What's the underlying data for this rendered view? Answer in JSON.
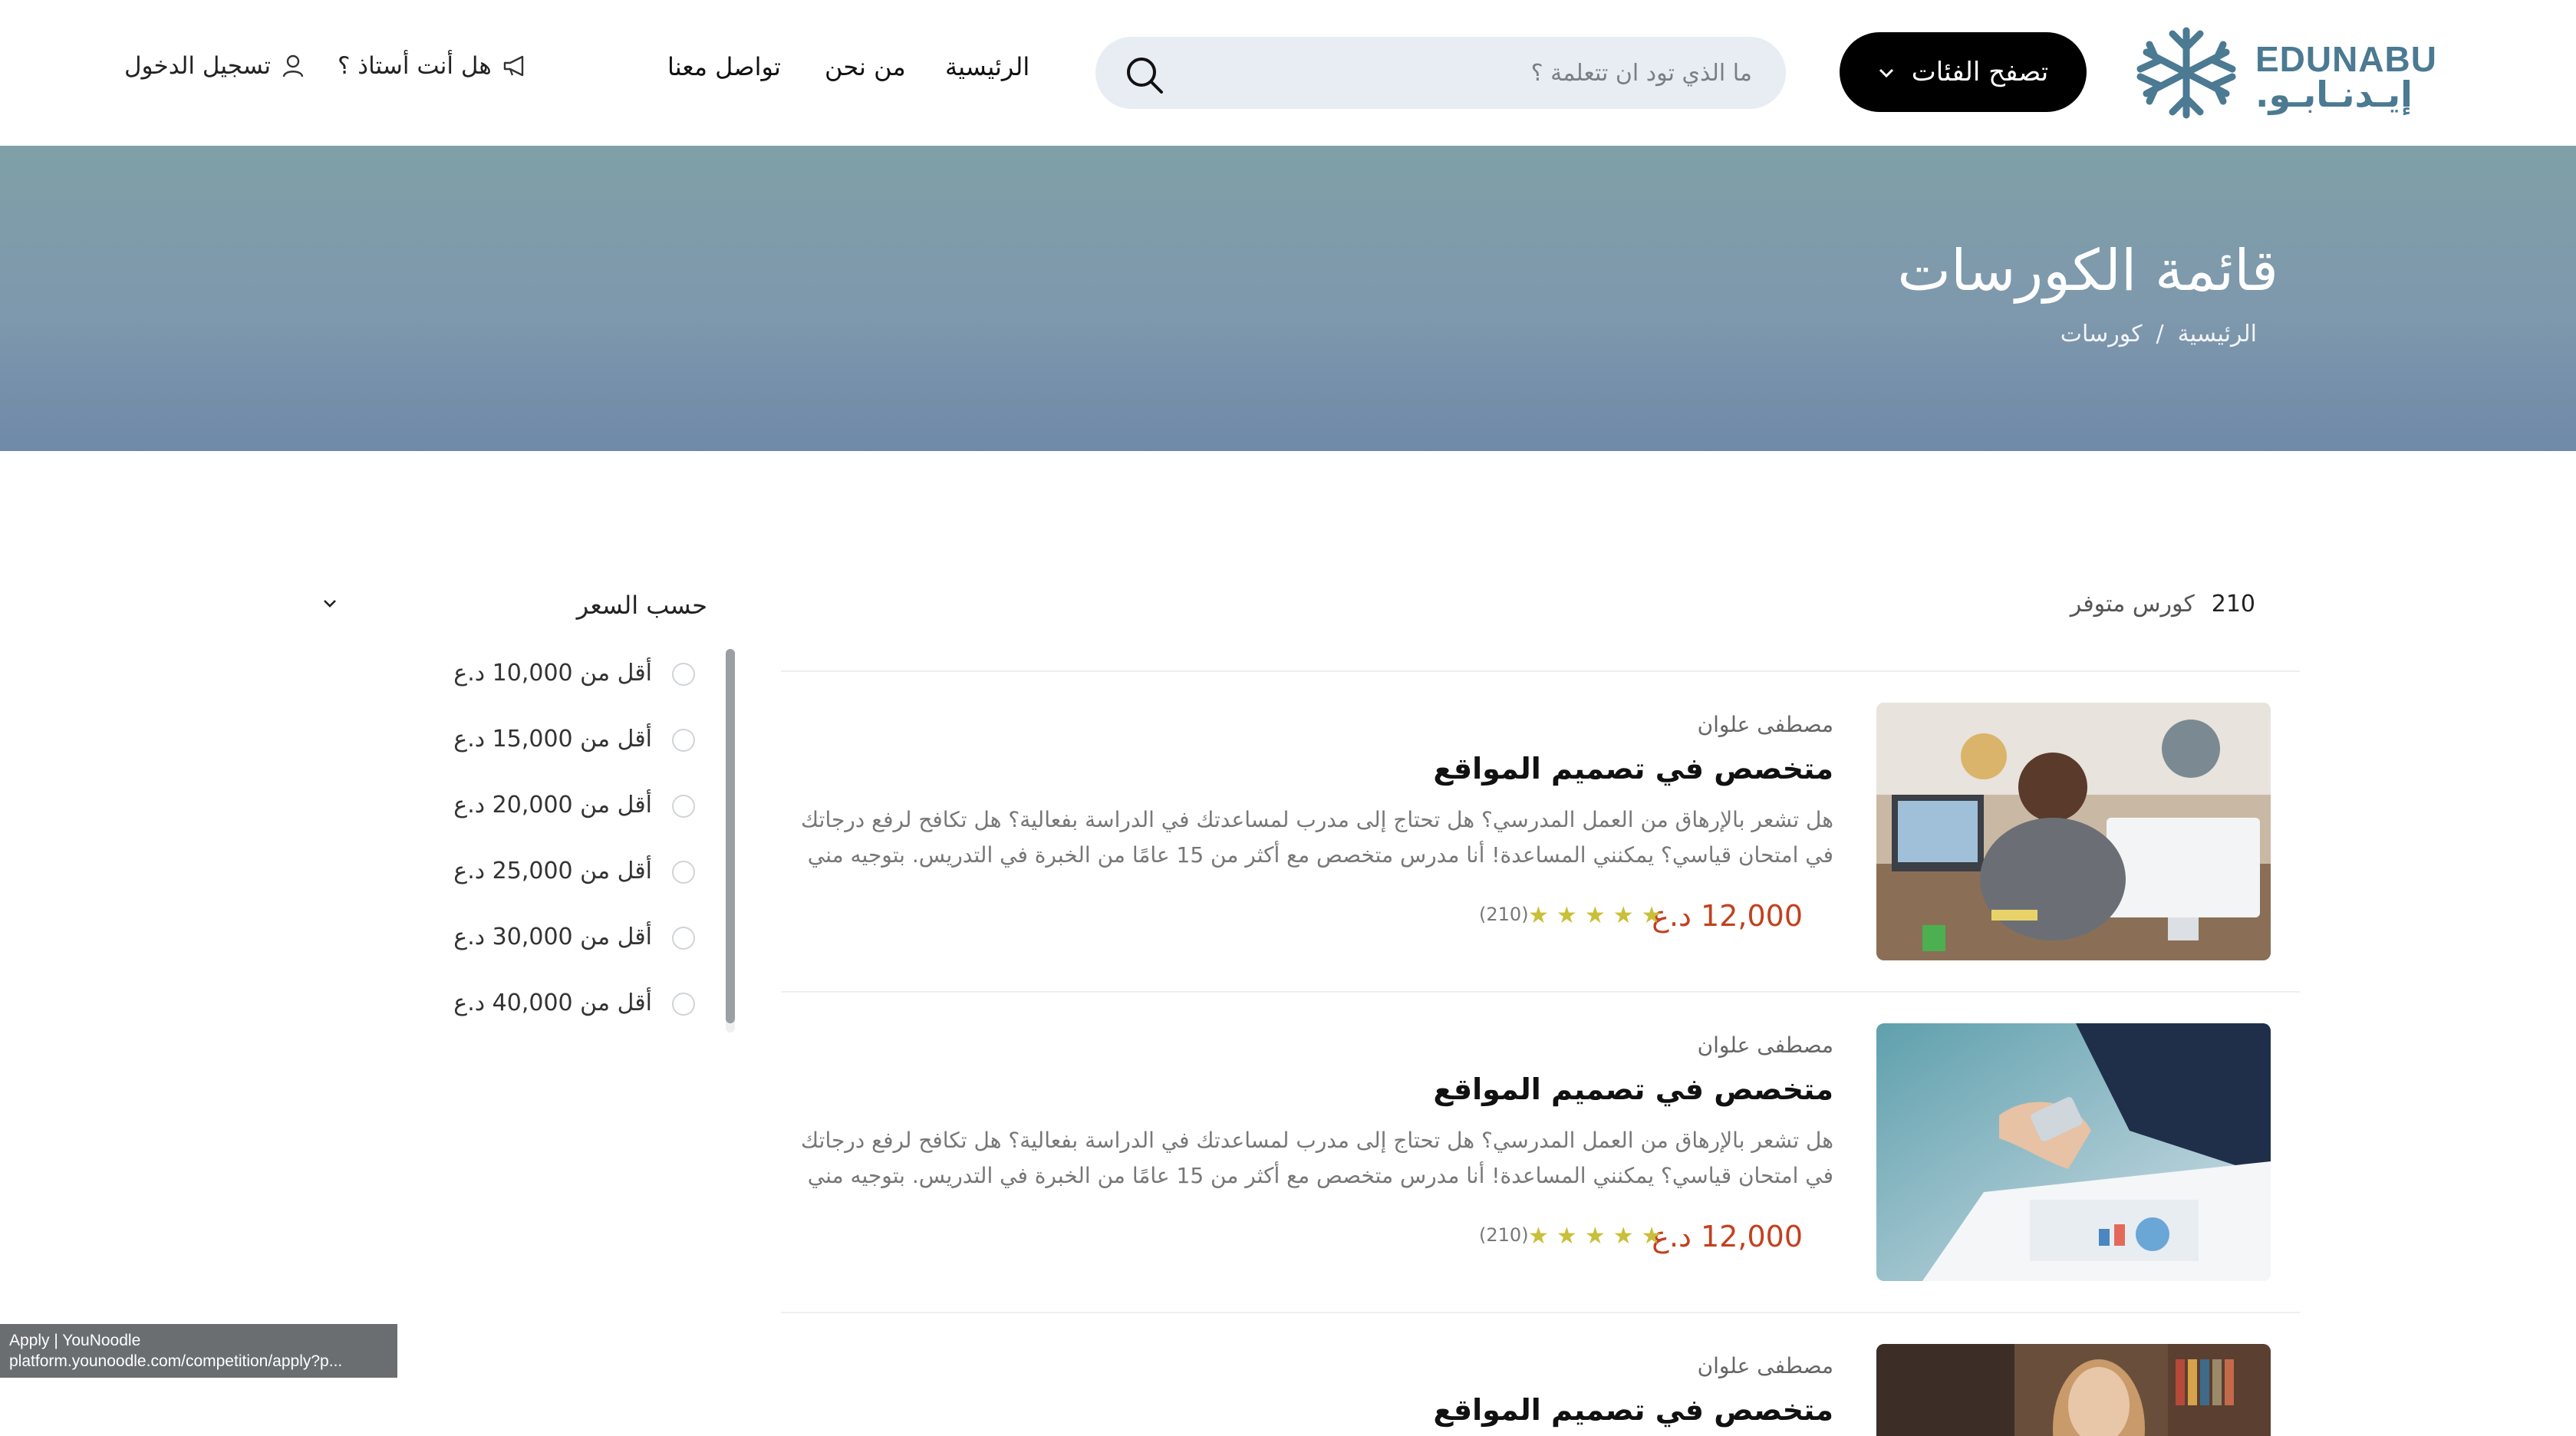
{
  "header": {
    "logo_en": "EDUNABU",
    "logo_ar": "إيـدنـابـو.",
    "browse_label": "تصفح الفئات",
    "search_placeholder": "ما الذي تود ان تتعلمة ؟",
    "nav": {
      "home": "الرئيسية",
      "about": "من نحن",
      "contact": "تواصل معنا"
    },
    "teacher_label": "هل أنت أستاذ ؟",
    "login_label": "تسجيل الدخول"
  },
  "hero": {
    "title": "قائمة الكورسات",
    "breadcrumb": {
      "home": "الرئيسية",
      "separator": "/",
      "current": "كورسات"
    }
  },
  "results": {
    "count": "210",
    "label": "كورس متوفر"
  },
  "courses": [
    {
      "author": "مصطفى علوان",
      "title": "متخصص في تصميم المواقع",
      "desc_line1": "هل تشعر بالإرهاق من العمل المدرسي؟ هل تحتاج إلى مدرب لمساعدتك في الدراسة بفعالية؟ هل تكافح لرفع درجاتك",
      "desc_line2": "في امتحان قياسي؟ يمكنني المساعدة! أنا مدرس متخصص مع أكثر من 15 عامًا من الخبرة في التدريس. بتوجيه مني",
      "price": "12,000 د.ع",
      "rating": 5,
      "reviews": "(210)"
    },
    {
      "author": "مصطفى علوان",
      "title": "متخصص في تصميم المواقع",
      "desc_line1": "هل تشعر بالإرهاق من العمل المدرسي؟ هل تحتاج إلى مدرب لمساعدتك في الدراسة بفعالية؟ هل تكافح لرفع درجاتك",
      "desc_line2": "في امتحان قياسي؟ يمكنني المساعدة! أنا مدرس متخصص مع أكثر من 15 عامًا من الخبرة في التدريس. بتوجيه مني",
      "price": "12,000 د.ع",
      "rating": 5,
      "reviews": "(210)"
    },
    {
      "author": "مصطفى علوان",
      "title": "متخصص في تصميم المواقع"
    }
  ],
  "filter": {
    "title": "حسب السعر",
    "options": [
      "أقل من 10,000 د.ع",
      "أقل من 15,000 د.ع",
      "أقل من 20,000 د.ع",
      "أقل من 25,000 د.ع",
      "أقل من 30,000 د.ع",
      "أقل من 40,000 د.ع"
    ]
  },
  "status_bar": {
    "line1": "Apply | YouNoodle",
    "line2": "platform.younoodle.com/competition/apply?p..."
  },
  "colors": {
    "accent": "#000000",
    "price": "#c2411f",
    "star": "#c9bf3a",
    "logo": "#4b7a92",
    "hero_top": "#7fa0a7",
    "hero_bottom": "#6f89a9"
  }
}
